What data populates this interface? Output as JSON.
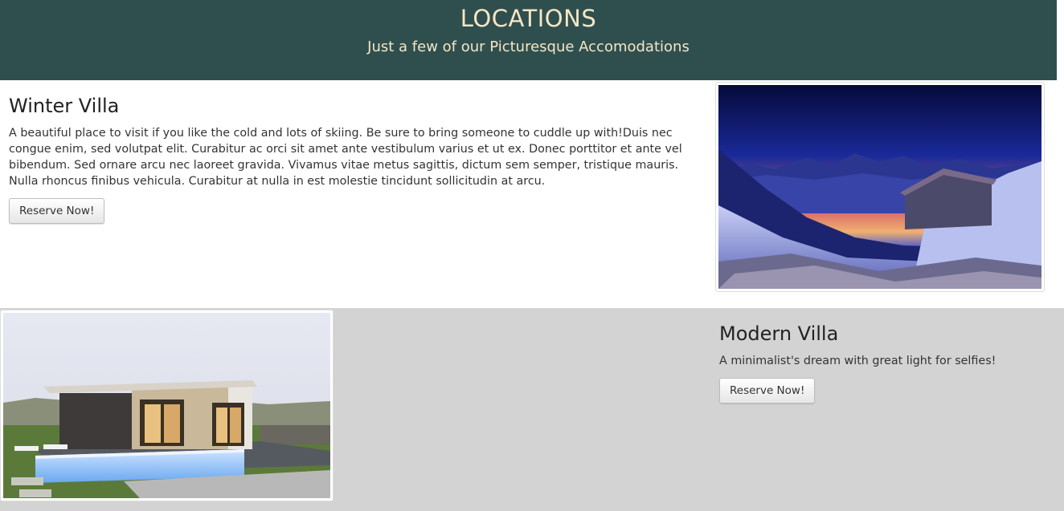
{
  "header": {
    "title": "LOCATIONS",
    "subtitle": "Just a few of our Picturesque Accomodations"
  },
  "villas": [
    {
      "name": "Winter Villa",
      "description": "A beautiful place to visit if you like the cold and lots of skiing. Be sure to bring someone to cuddle up with!Duis nec congue enim, sed volutpat elit. Curabitur ac orci sit amet ante vestibulum varius et ut ex. Donec porttitor et ante vel bibendum. Sed ornare arcu nec laoreet gravida. Vivamus vitae metus sagittis, dictum sem semper, tristique mauris. Nulla rhoncus finibus vehicula. Curabitur at nulla in est molestie tincidunt sollicitudin at arcu.",
      "button_label": "Reserve Now!",
      "image_icon": "snowy-mountain-cabin-photo"
    },
    {
      "name": "Modern Villa",
      "description": "A minimalist's dream with great light for selfies!",
      "button_label": "Reserve Now!",
      "image_icon": "modern-house-pool-photo"
    }
  ],
  "colors": {
    "header_bg": "#2f4f4f",
    "header_text": "#f5e6c4",
    "section_alt_bg": "#d3d3d3"
  }
}
